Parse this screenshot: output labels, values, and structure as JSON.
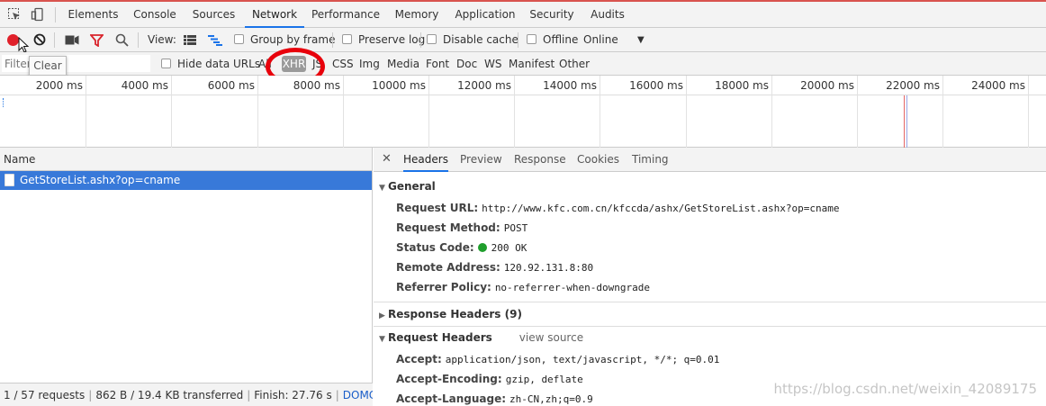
{
  "tabs": [
    "Elements",
    "Console",
    "Sources",
    "Network",
    "Performance",
    "Memory",
    "Application",
    "Security",
    "Audits"
  ],
  "toolbar": {
    "view_label": "View:",
    "group_by_frame": "Group by frame",
    "preserve_log": "Preserve log",
    "disable_cache": "Disable cache",
    "offline": "Offline",
    "throttle": "Online"
  },
  "filterbar": {
    "placeholder": "Filter",
    "hide_data_urls": "Hide data URLs",
    "all": "All",
    "xhr": "XHR",
    "js": "JS",
    "css": "CSS",
    "img": "Img",
    "media": "Media",
    "font": "Font",
    "doc": "Doc",
    "ws": "WS",
    "manifest": "Manifest",
    "other": "Other"
  },
  "tooltip": "Clear",
  "timeline": {
    "ticks": [
      "2000 ms",
      "4000 ms",
      "6000 ms",
      "8000 ms",
      "10000 ms",
      "12000 ms",
      "14000 ms",
      "16000 ms",
      "18000 ms",
      "20000 ms",
      "22000 ms",
      "24000 ms"
    ]
  },
  "requests": {
    "header": "Name",
    "rows": [
      "GetStoreList.ashx?op=cname"
    ]
  },
  "statusbar": {
    "requests": "1 / 57 requests",
    "transferred": "862 B / 19.4 KB transferred",
    "finish": "Finish: 27.76 s",
    "dom": "DOMConte..."
  },
  "detail": {
    "tabs": [
      "Headers",
      "Preview",
      "Response",
      "Cookies",
      "Timing"
    ],
    "general_title": "General",
    "general": [
      {
        "key": "Request URL:",
        "value": "http://www.kfc.com.cn/kfccda/ashx/GetStoreList.ashx?op=cname"
      },
      {
        "key": "Request Method:",
        "value": "POST"
      },
      {
        "key": "Status Code:",
        "value": "200 OK"
      },
      {
        "key": "Remote Address:",
        "value": "120.92.131.8:80"
      },
      {
        "key": "Referrer Policy:",
        "value": "no-referrer-when-downgrade"
      }
    ],
    "response_headers_title": "Response Headers (9)",
    "request_headers_title": "Request Headers",
    "view_source": "view source",
    "request_headers": [
      {
        "key": "Accept:",
        "value": "application/json, text/javascript, */*; q=0.01"
      },
      {
        "key": "Accept-Encoding:",
        "value": "gzip, deflate"
      },
      {
        "key": "Accept-Language:",
        "value": "zh-CN,zh;q=0.9"
      }
    ]
  },
  "watermark": "https://blog.csdn.net/weixin_42089175"
}
